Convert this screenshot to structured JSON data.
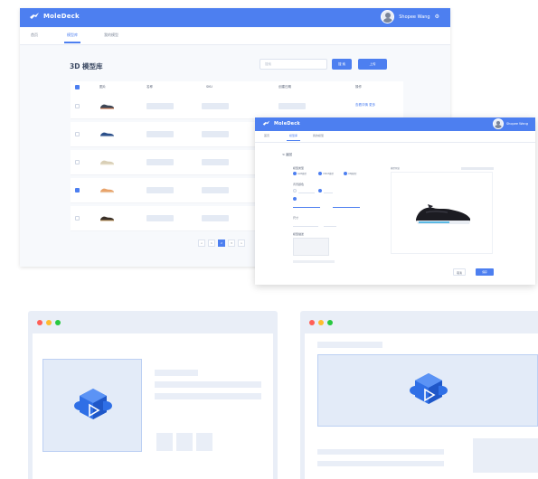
{
  "app": {
    "brand": "MoleDeck",
    "user_name": "Shopee Wang",
    "tabs": [
      "首页",
      "模型库",
      "我的模型"
    ],
    "active_tab": 1,
    "page_title": "3D 模型库",
    "search_placeholder": "搜索",
    "search_button": "搜 索",
    "upload_button": "上传",
    "columns": [
      "图片",
      "名称",
      "SKU",
      "创建日期",
      "操作"
    ],
    "rows": [
      {
        "checked": false,
        "actions": "查看详情 更多"
      },
      {
        "checked": false,
        "actions": ""
      },
      {
        "checked": false,
        "actions": ""
      },
      {
        "checked": true,
        "actions": ""
      },
      {
        "checked": false,
        "actions": ""
      }
    ],
    "pagination": [
      "<",
      "1",
      "2",
      "3",
      ">"
    ],
    "current_page": "2"
  },
  "overlay": {
    "brand": "MoleDeck",
    "user_name": "Shopee Wang",
    "tabs": [
      "首页",
      "模型库",
      "我的模型"
    ],
    "active_tab": 1,
    "back_label": "< 返回",
    "section1_label": "模型类型",
    "section1_options": [
      "GLB模型",
      "USDZ模型",
      "OBJ模型"
    ],
    "section2_label": "背景颜色",
    "section3_label": "尺寸",
    "section4_label": "模型描述",
    "preview_label": "模型预览",
    "cancel_button": "取消",
    "save_button": "保存"
  },
  "icons": {
    "logo": "moledeck-bird-icon",
    "settings": "gear-icon",
    "placeholder": "3d-cube-play-icon"
  },
  "colors": {
    "brand_blue": "#4d7ff0",
    "mac_red": "#ff5f57",
    "mac_yellow": "#febc2e",
    "mac_green": "#28c840"
  }
}
